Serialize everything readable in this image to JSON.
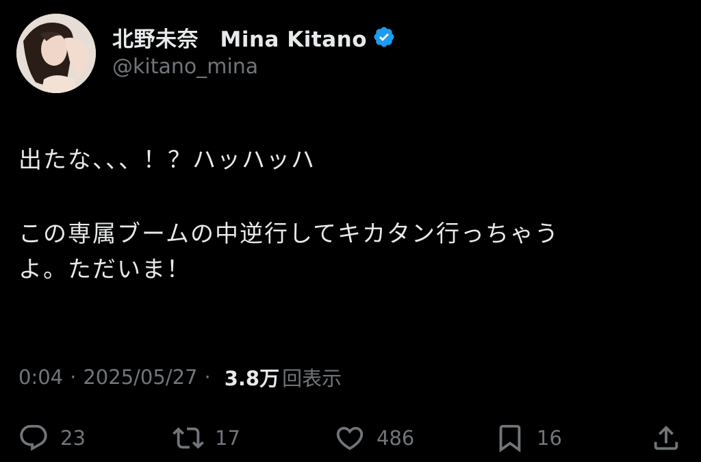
{
  "author": {
    "display_name": "北野未奈　Mina Kitano",
    "handle": "@kitano_mina",
    "verified_icon": "verified-badge-icon",
    "accent_color": "#1d9bf0"
  },
  "tweet": {
    "line1": "出たな、、、！？ハッハッハ",
    "line2": "この専属ブームの中逆行してキカタン行っちゃう",
    "line3": "よ。ただいま！"
  },
  "meta": {
    "time": "0:04",
    "separator": "·",
    "date": "2025/05/27",
    "views_count": "3.8万",
    "views_label": "回表示"
  },
  "actions": {
    "replies": "23",
    "retweets": "17",
    "likes": "486",
    "bookmarks": "16"
  }
}
